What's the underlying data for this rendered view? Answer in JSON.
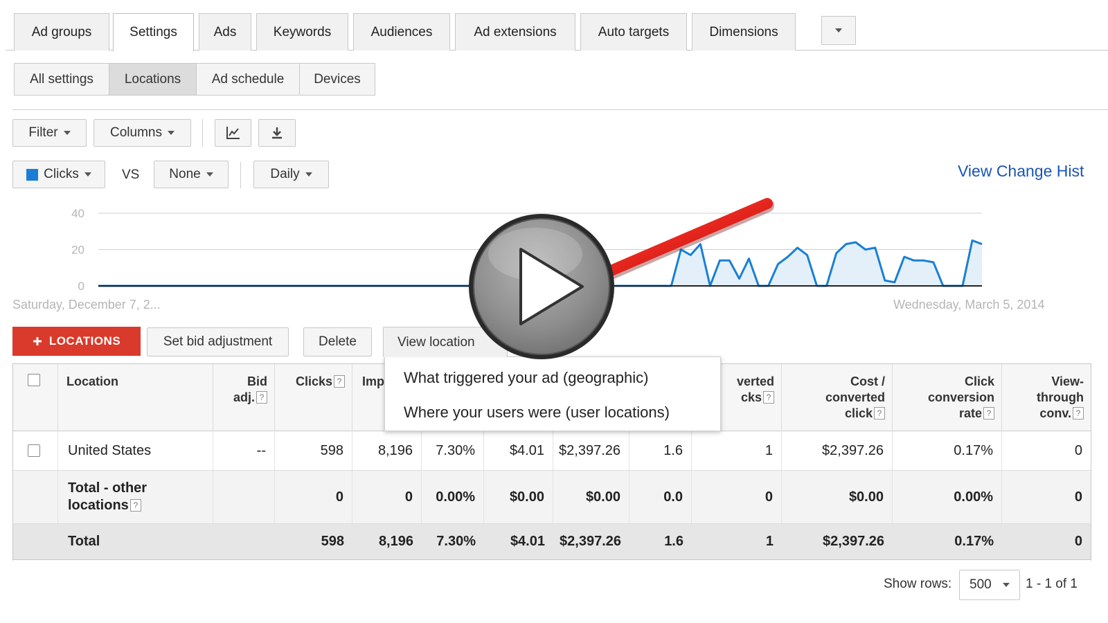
{
  "tabs": [
    {
      "label": "Ad groups",
      "active": false
    },
    {
      "label": "Settings",
      "active": true
    },
    {
      "label": "Ads",
      "active": false
    },
    {
      "label": "Keywords",
      "active": false
    },
    {
      "label": "Audiences",
      "active": false
    },
    {
      "label": "Ad extensions",
      "active": false
    },
    {
      "label": "Auto targets",
      "active": false
    },
    {
      "label": "Dimensions",
      "active": false
    }
  ],
  "subtabs": [
    {
      "label": "All settings",
      "active": false
    },
    {
      "label": "Locations",
      "active": true
    },
    {
      "label": "Ad schedule",
      "active": false
    },
    {
      "label": "Devices",
      "active": false
    }
  ],
  "toolbar": {
    "filter": "Filter",
    "columns": "Columns",
    "chart_icon": "line-chart-icon",
    "download_icon": "download-icon"
  },
  "chart_controls": {
    "metric": "Clicks",
    "metric_color": "#1a7fd4",
    "vs": "VS",
    "compare": "None",
    "period": "Daily",
    "view_change_history": "View Change Hist"
  },
  "chart_data": {
    "type": "area",
    "title": "",
    "xlabel": "",
    "ylabel": "",
    "ylim": [
      0,
      40
    ],
    "yticks": [
      0,
      20,
      40
    ],
    "start_label": "Saturday, December 7, 2...",
    "end_label": "Wednesday, March 5, 2014",
    "series": [
      {
        "name": "Clicks",
        "color": "#1a7fd4",
        "values": [
          0,
          0,
          0,
          0,
          0,
          0,
          0,
          0,
          0,
          0,
          0,
          0,
          0,
          0,
          0,
          0,
          0,
          0,
          0,
          0,
          0,
          0,
          0,
          0,
          0,
          0,
          0,
          0,
          0,
          0,
          0,
          0,
          0,
          0,
          0,
          0,
          0,
          0,
          0,
          0,
          0,
          0,
          0,
          0,
          0,
          0,
          0,
          0,
          0,
          0,
          0,
          0,
          0,
          0,
          0,
          0,
          0,
          0,
          0,
          0,
          20,
          17,
          23,
          0,
          14,
          14,
          4,
          15,
          0,
          0,
          12,
          16,
          21,
          17,
          0,
          0,
          18,
          23,
          24,
          20,
          21,
          3,
          2,
          16,
          14,
          14,
          13,
          0,
          0,
          0,
          25,
          23
        ]
      }
    ]
  },
  "actions": {
    "add_locations": "LOCATIONS",
    "plus_icon": "plus-icon",
    "set_bid": "Set bid adjustment",
    "delete": "Delete",
    "view_location": "View location"
  },
  "dropdown": {
    "items": [
      "What triggered your ad (geographic)",
      "Where your users were (user locations)"
    ]
  },
  "table": {
    "headers": {
      "location": "Location",
      "bid_adj": [
        "Bid",
        "adj."
      ],
      "clicks": "Clicks",
      "impr": "Impr.",
      "converted_clicks": [
        "verted",
        "cks"
      ],
      "cost_converted": [
        "Cost /",
        "converted",
        "click"
      ],
      "click_conv_rate": [
        "Click",
        "conversion",
        "rate"
      ],
      "view_through": [
        "View-",
        "through",
        "conv."
      ]
    },
    "rows": [
      {
        "location": "United States",
        "bid_adj": "--",
        "clicks": "598",
        "impr": "8,196",
        "ctr": "7.30%",
        "cpc": "$4.01",
        "cost": "$2,397.26",
        "pos": "1.6",
        "conv": "1",
        "cost_conv": "$2,397.26",
        "rate": "0.17%",
        "vt": "0"
      },
      {
        "location_l1": "Total - other",
        "location_l2": "locations",
        "clicks": "0",
        "impr": "0",
        "ctr": "0.00%",
        "cpc": "$0.00",
        "cost": "$0.00",
        "pos": "0.0",
        "conv": "0",
        "cost_conv": "$0.00",
        "rate": "0.00%",
        "vt": "0"
      },
      {
        "location": "Total",
        "clicks": "598",
        "impr": "8,196",
        "ctr": "7.30%",
        "cpc": "$4.01",
        "cost": "$2,397.26",
        "pos": "1.6",
        "conv": "1",
        "cost_conv": "$2,397.26",
        "rate": "0.17%",
        "vt": "0"
      }
    ]
  },
  "pagination": {
    "show_rows_label": "Show rows:",
    "rows_value": "500",
    "range": "1 - 1 of 1"
  },
  "overlay": {
    "play_icon": "play-button-icon",
    "arrow_icon": "red-arrow-icon",
    "arrow_color": "#e01010"
  },
  "qmark": "?"
}
